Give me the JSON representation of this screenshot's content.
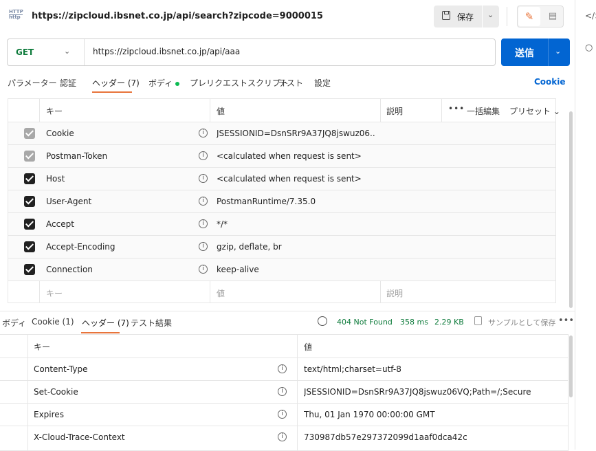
{
  "tab_title": "https://zipcloud.ibsnet.co.jp/api/search?zipcode=9000015",
  "http_icon": {
    "top": "HTTP",
    "bottom": "http"
  },
  "toolbar": {
    "save_label": "保存"
  },
  "request": {
    "method": "GET",
    "url": "https://zipcloud.ibsnet.co.jp/api/aaa",
    "send_label": "送信"
  },
  "request_tabs": [
    {
      "label": "パラメーター"
    },
    {
      "label": "認証"
    },
    {
      "label": "ヘッダー (7)"
    },
    {
      "label": "ボディ"
    },
    {
      "label": "プレリクエストスクリプト"
    },
    {
      "label": "テスト"
    },
    {
      "label": "設定"
    }
  ],
  "cookie_link": "Cookie",
  "req_table": {
    "headers": {
      "key": "キー",
      "value": "値",
      "description": "説明",
      "bulk_edit": "一括編集",
      "presets": "プリセット"
    },
    "rows": [
      {
        "key": "Cookie",
        "value": "JSESSIONID=DsnSRr9A37JQ8jswuz06...",
        "checked": true,
        "disabled": true
      },
      {
        "key": "Postman-Token",
        "value": "<calculated when request is sent>",
        "checked": true,
        "disabled": true
      },
      {
        "key": "Host",
        "value": "<calculated when request is sent>",
        "checked": true,
        "disabled": false
      },
      {
        "key": "User-Agent",
        "value": "PostmanRuntime/7.35.0",
        "checked": true,
        "disabled": false
      },
      {
        "key": "Accept",
        "value": "*/*",
        "checked": true,
        "disabled": false
      },
      {
        "key": "Accept-Encoding",
        "value": "gzip, deflate, br",
        "checked": true,
        "disabled": false
      },
      {
        "key": "Connection",
        "value": "keep-alive",
        "checked": true,
        "disabled": false
      }
    ],
    "placeholder": {
      "key": "キー",
      "value": "値",
      "description": "説明"
    }
  },
  "response_tabs": [
    {
      "label": "ボディ"
    },
    {
      "label": "Cookie (1)"
    },
    {
      "label": "ヘッダー (7)"
    },
    {
      "label": "テスト結果"
    }
  ],
  "response_status": {
    "code": "404 Not Found",
    "time": "358 ms",
    "size": "2.29 KB",
    "save_example": "サンプルとして保存"
  },
  "resp_table": {
    "headers": {
      "key": "キー",
      "value": "値"
    },
    "rows": [
      {
        "key": "Content-Type",
        "value": "text/html;charset=utf-8"
      },
      {
        "key": "Set-Cookie",
        "value": "JSESSIONID=DsnSRr9A37JQ8jswuz06VQ;Path=/;Secure"
      },
      {
        "key": "Expires",
        "value": "Thu, 01 Jan 1970 00:00:00 GMT"
      },
      {
        "key": "X-Cloud-Trace-Context",
        "value": "730987db57e297372099d1aaf0dca42c"
      }
    ]
  },
  "colors": {
    "accent": "#e8743b",
    "send": "#0265d2",
    "status_ok": "#0c7a3a",
    "dot": "#0cbb52"
  },
  "right_rail": {
    "code_icon": "</>"
  }
}
